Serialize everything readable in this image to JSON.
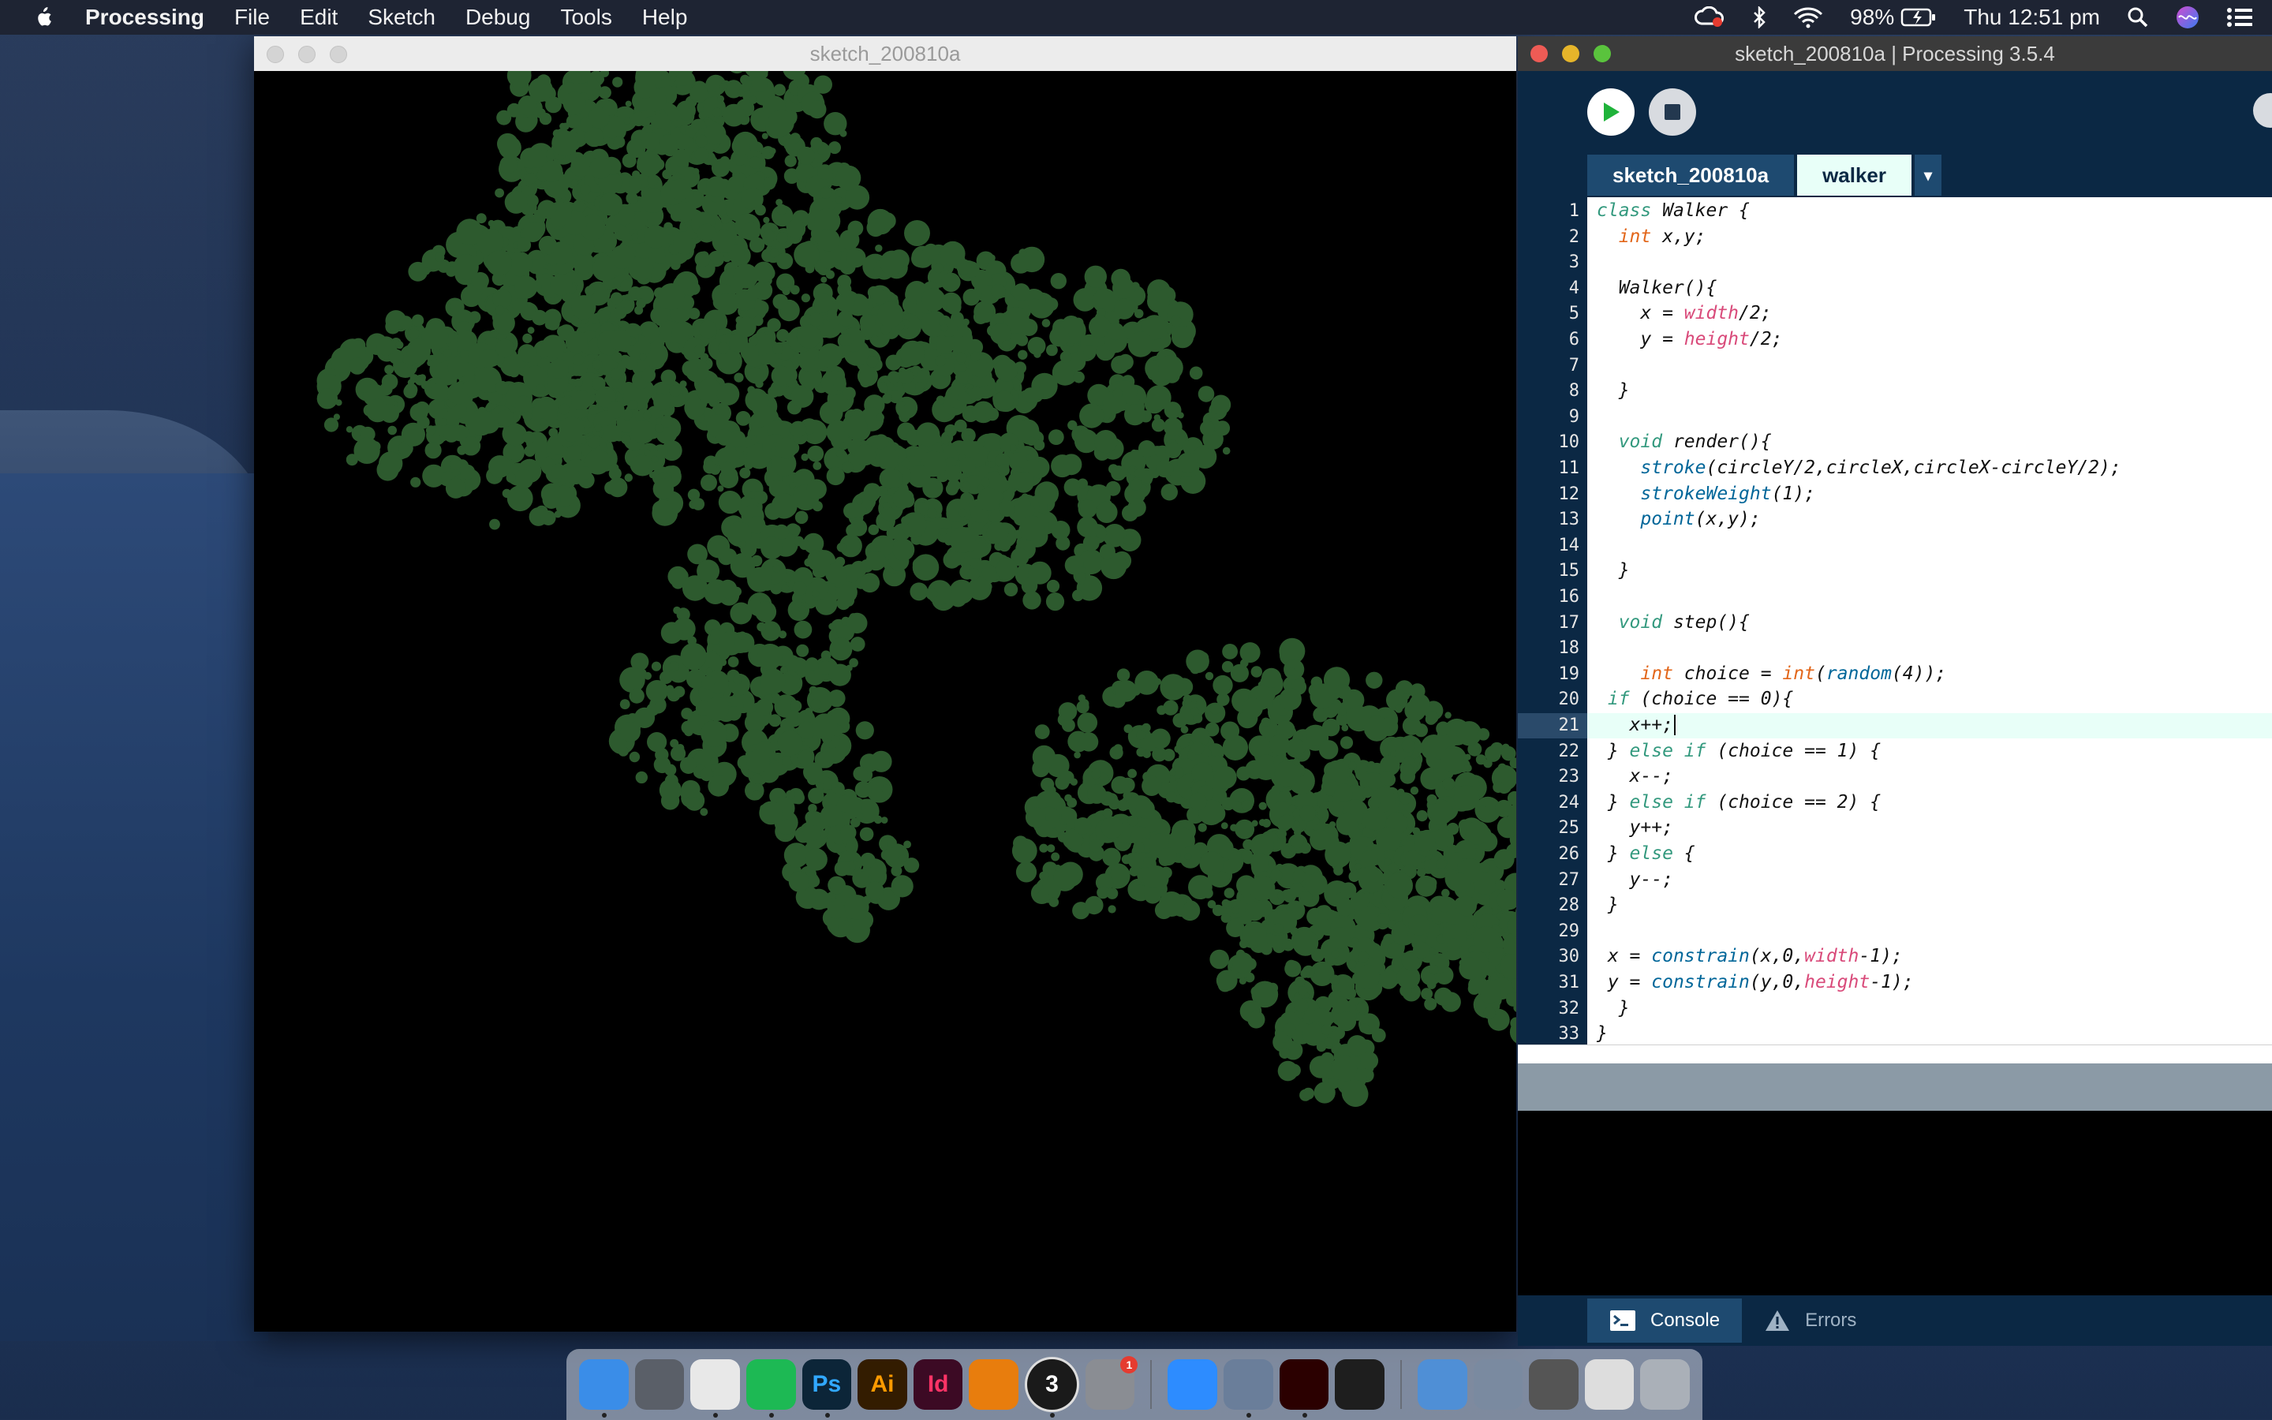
{
  "menubar": {
    "app_name": "Processing",
    "menus": [
      "File",
      "Edit",
      "Sketch",
      "Debug",
      "Tools",
      "Help"
    ],
    "battery": "98%",
    "clock": "Thu 12:51 pm"
  },
  "sketch_window": {
    "title": "sketch_200810a",
    "fill_color": "#2d5a2e"
  },
  "pde_window": {
    "title": "sketch_200810a | Processing 3.5.4",
    "tabs": [
      "sketch_200810a",
      "walker"
    ],
    "active_tab": "walker",
    "tab_menu_glyph": "▾",
    "current_line": 21,
    "code_lines": [
      "class Walker {",
      "  int x,y;",
      "",
      "  Walker(){",
      "    x = width/2;",
      "    y = height/2;",
      "",
      "  }",
      "",
      "  void render(){",
      "    stroke(circleY/2,circleX,circleX-circleY/2);",
      "    strokeWeight(1);",
      "    point(x,y);",
      "",
      "  }",
      "",
      "  void step(){",
      "",
      "    int choice = int(random(4));",
      " if (choice == 0){",
      "   x++;",
      " } else if (choice == 1) {",
      "   x--;",
      " } else if (choice == 2) {",
      "   y++;",
      " } else {",
      "   y--;",
      " }",
      "",
      " x = constrain(x,0,width-1);",
      " y = constrain(y,0,height-1);",
      "  }",
      "}"
    ],
    "console_tab": "Console",
    "errors_tab": "Errors"
  },
  "dock": {
    "apps": [
      {
        "name": "Finder",
        "glyph": "",
        "color": "#3a8de8",
        "running": true
      },
      {
        "name": "Launchpad",
        "glyph": "",
        "color": "#5a5f68",
        "running": false
      },
      {
        "name": "Chrome",
        "glyph": "",
        "color": "#e8e8e8",
        "running": true
      },
      {
        "name": "Spotify",
        "glyph": "",
        "color": "#1db954",
        "running": true
      },
      {
        "name": "Photoshop",
        "glyph": "Ps",
        "color": "#0c2538",
        "running": true
      },
      {
        "name": "Illustrator",
        "glyph": "Ai",
        "color": "#331c00",
        "running": false
      },
      {
        "name": "InDesign",
        "glyph": "Id",
        "color": "#3c0a24",
        "running": false
      },
      {
        "name": "Blender",
        "glyph": "",
        "color": "#e87d0d",
        "running": false
      },
      {
        "name": "Processing",
        "glyph": "3",
        "color": "#1a1a1a",
        "running": true
      },
      {
        "name": "System Preferences",
        "glyph": "",
        "color": "#8a8d93",
        "running": false,
        "badge": "1"
      },
      {
        "name": "Zoom",
        "glyph": "",
        "color": "#2d8cff",
        "running": false
      },
      {
        "name": "Preview",
        "glyph": "",
        "color": "#6a7e9a",
        "running": true
      },
      {
        "name": "Acrobat",
        "glyph": "",
        "color": "#2b0000",
        "running": true
      },
      {
        "name": "QuickTime",
        "glyph": "",
        "color": "#1e1e1e",
        "running": false
      },
      {
        "name": "Applications",
        "glyph": "",
        "color": "#4f8fd6",
        "running": false
      },
      {
        "name": "Photo",
        "glyph": "",
        "color": "#7a8aa0",
        "running": false
      },
      {
        "name": "Document",
        "glyph": "",
        "color": "#555",
        "running": false
      },
      {
        "name": "Screenshot",
        "glyph": "",
        "color": "#ddd",
        "running": false
      },
      {
        "name": "Trash",
        "glyph": "",
        "color": "#aab0b8",
        "running": false
      }
    ]
  }
}
